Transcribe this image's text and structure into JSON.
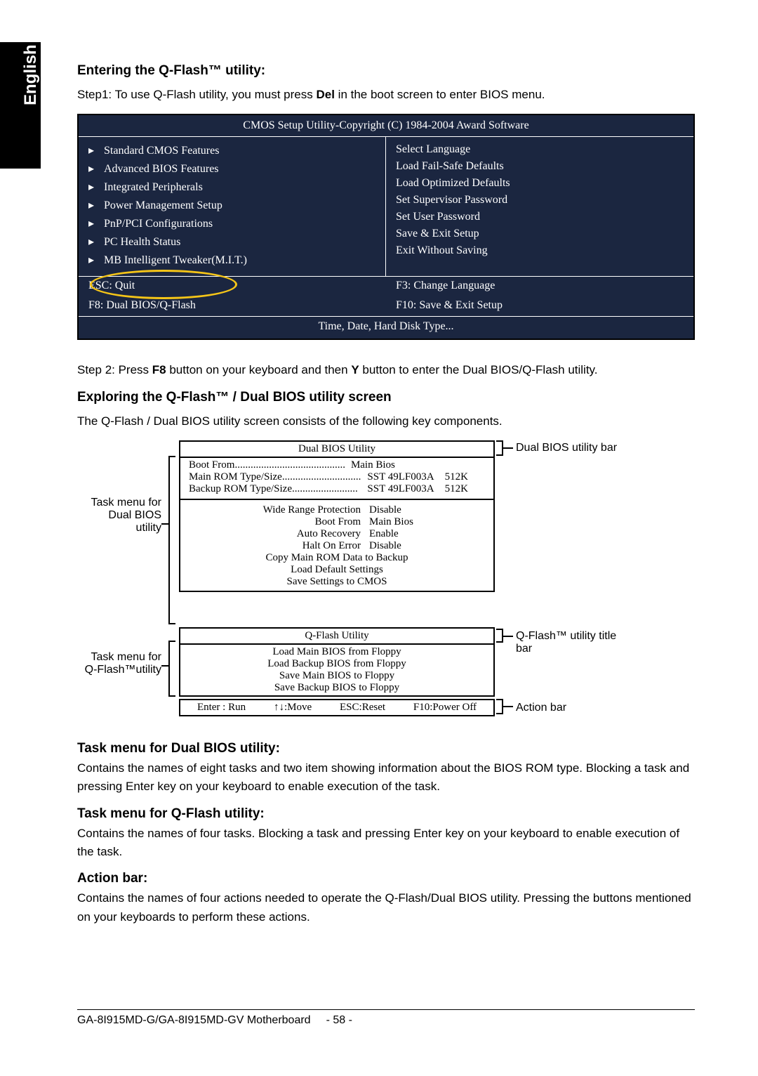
{
  "side_label": "English",
  "section1_title": "Entering the Q-Flash™ utility:",
  "step1_a": "Step1: To use Q-Flash utility, you must press ",
  "step1_key": "Del",
  "step1_b": " in the boot screen to enter BIOS menu.",
  "bios": {
    "title": "CMOS Setup Utility-Copyright (C) 1984-2004 Award Software",
    "left": [
      "Standard CMOS Features",
      "Advanced BIOS Features",
      "Integrated Peripherals",
      "Power Management Setup",
      "PnP/PCI Configurations",
      "PC Health Status",
      "MB Intelligent Tweaker(M.I.T.)"
    ],
    "right": [
      "Select Language",
      "Load Fail-Safe Defaults",
      "Load Optimized Defaults",
      "Set Supervisor Password",
      "Set User Password",
      "Save & Exit Setup",
      "Exit Without Saving"
    ],
    "hint_tl": "ESC: Quit",
    "hint_tr": "F3: Change Language",
    "hint_bl": "F8: Dual BIOS/Q-Flash",
    "hint_br": "F10: Save & Exit Setup",
    "footer": "Time, Date, Hard Disk Type..."
  },
  "step2_a": "Step 2: Press ",
  "step2_key1": "F8",
  "step2_b": " button on your keyboard and then ",
  "step2_key2": "Y",
  "step2_c": " button to enter the Dual BIOS/Q-Flash utility.",
  "section2_title": "Exploring the Q-Flash™ / Dual BIOS utility screen",
  "section2_intro": "The Q-Flash / Dual BIOS utility screen consists of the following key components.",
  "diagram": {
    "label_dual_bios_bar": "Dual BIOS utility bar",
    "label_task_dual_a": "Task menu for",
    "label_task_dual_b": "Dual BIOS",
    "label_task_dual_c": "utility",
    "label_task_qflash_a": "Task menu for",
    "label_task_qflash_b": "Q-Flash™utility",
    "label_qflash_bar_a": "Q-Flash™ utility title",
    "label_qflash_bar_b": "bar",
    "label_action_bar": "Action bar",
    "dual_header": "Dual BIOS Utility",
    "boot_label": "Boot From",
    "boot_dots": "..........................................",
    "boot_value": "Main Bios",
    "main_rom_l": "Main ROM Type/Size",
    "main_rom_dots": "..............................",
    "main_rom_m": "SST 49LF003A",
    "main_rom_r": "512K",
    "backup_rom_l": "Backup ROM Type/Size",
    "backup_rom_dots": ".........................",
    "backup_rom_m": "SST 49LF003A",
    "backup_rom_r": "512K",
    "settings": [
      {
        "l": "Wide Range Protection",
        "r": "Disable"
      },
      {
        "l": "Boot From",
        "r": "Main Bios"
      },
      {
        "l": "Auto Recovery",
        "r": "Enable"
      },
      {
        "l": "Halt On Error",
        "r": "Disable"
      }
    ],
    "cmds1": [
      "Copy Main ROM Data to Backup",
      "Load Default Settings",
      "Save Settings to CMOS"
    ],
    "qflash_header": "Q-Flash Utility",
    "cmds2": [
      "Load Main BIOS from Floppy",
      "Load Backup BIOS from Floppy",
      "Save Main BIOS to Floppy",
      "Save Backup BIOS to Floppy"
    ],
    "action_items": [
      "Enter : Run",
      "↑↓:Move",
      "ESC:Reset",
      "F10:Power Off"
    ]
  },
  "sec_task_dual_h": "Task menu for Dual BIOS utility:",
  "sec_task_dual_p": "Contains the names of eight tasks and two item showing information about the BIOS ROM type. Blocking a task and pressing Enter key on your keyboard to enable execution of the task.",
  "sec_task_q_h": "Task menu for Q-Flash utility:",
  "sec_task_q_p": "Contains the names of four tasks. Blocking a task and pressing Enter key on your keyboard to enable execution of the task.",
  "sec_action_h": "Action bar:",
  "sec_action_p": "Contains the names of four actions needed to operate the Q-Flash/Dual BIOS utility. Pressing the buttons mentioned on your keyboards to perform these actions.",
  "footer_model": "GA-8I915MD-G/GA-8I915MD-GV Motherboard",
  "footer_page": "- 58 -"
}
